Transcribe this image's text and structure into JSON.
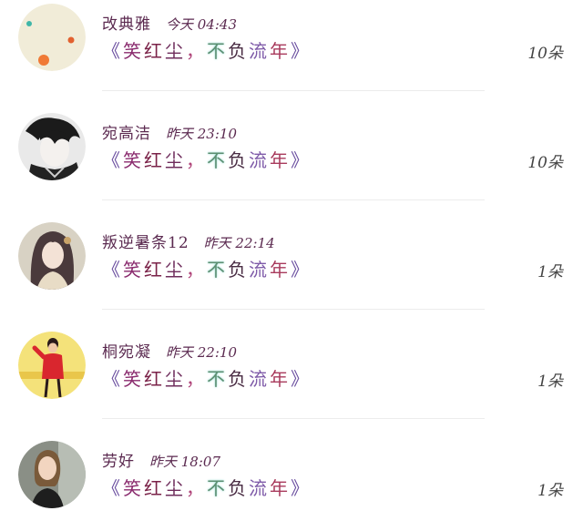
{
  "entries": [
    {
      "name": "改典雅",
      "time": "今天 04:43",
      "gift_open": "《",
      "gift_ch1": "笑",
      "gift_ch2": "红",
      "gift_ch3": "尘",
      "gift_comma": "，",
      "gift_ch4": "不",
      "gift_ch5": "负",
      "gift_ch6": "流",
      "gift_ch7": "年",
      "gift_close": "》",
      "count": "10朵",
      "avatar_icon": "dots-avatar-icon"
    },
    {
      "name": "宛高洁",
      "time": "昨天 23:10",
      "gift_open": "《",
      "gift_ch1": "笑",
      "gift_ch2": "红",
      "gift_ch3": "尘",
      "gift_comma": "，",
      "gift_ch4": "不",
      "gift_ch5": "负",
      "gift_ch6": "流",
      "gift_ch7": "年",
      "gift_close": "》",
      "count": "10朵",
      "avatar_icon": "anime-boy-avatar-icon"
    },
    {
      "name": "叛逆暑条12",
      "time": "昨天 22:14",
      "gift_open": "《",
      "gift_ch1": "笑",
      "gift_ch2": "红",
      "gift_ch3": "尘",
      "gift_comma": "，",
      "gift_ch4": "不",
      "gift_ch5": "负",
      "gift_ch6": "流",
      "gift_ch7": "年",
      "gift_close": "》",
      "count": "1朵",
      "avatar_icon": "anime-girl-avatar-icon"
    },
    {
      "name": "桐宛凝",
      "time": "昨天 22:10",
      "gift_open": "《",
      "gift_ch1": "笑",
      "gift_ch2": "红",
      "gift_ch3": "尘",
      "gift_comma": "，",
      "gift_ch4": "不",
      "gift_ch5": "负",
      "gift_ch6": "流",
      "gift_ch7": "年",
      "gift_close": "》",
      "count": "1朵",
      "avatar_icon": "red-dress-avatar-icon"
    },
    {
      "name": "劳好",
      "time": "昨天 18:07",
      "gift_open": "《",
      "gift_ch1": "笑",
      "gift_ch2": "红",
      "gift_ch3": "尘",
      "gift_comma": "，",
      "gift_ch4": "不",
      "gift_ch5": "负",
      "gift_ch6": "流",
      "gift_ch7": "年",
      "gift_close": "》",
      "count": "1朵",
      "avatar_icon": "woman-photo-avatar-icon"
    }
  ],
  "colors": {
    "name": "#5b2a50",
    "count": "#444444",
    "divider": "#ececec"
  }
}
